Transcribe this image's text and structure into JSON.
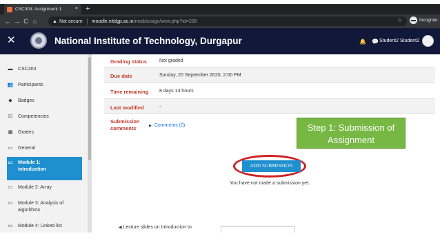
{
  "browser": {
    "tab_title": "CSC303: Assignment 1",
    "tab_close": "×",
    "new_tab": "+",
    "security_label": "Not secure",
    "url_host": "moodle.nitdgp.ac.in",
    "url_path": "/mod/assign/view.php?id=208",
    "incognito_label": "Incognito",
    "back_icon": "←",
    "forward_icon": "→",
    "reload_icon": "C",
    "home_icon": "⌂",
    "warning_icon": "▲",
    "star_icon": "☆"
  },
  "navbar": {
    "close_icon": "✕",
    "site_title": "National Institute of Technology, Durgapur",
    "bell_icon": "🔔",
    "message_icon": "💬",
    "user_name": "Student2 Student2"
  },
  "sidebar": {
    "items": [
      {
        "icon": "▬",
        "label": "CSC303"
      },
      {
        "icon": "👥",
        "label": "Participants"
      },
      {
        "icon": "◆",
        "label": "Badges"
      },
      {
        "icon": "☑",
        "label": "Competencies"
      },
      {
        "icon": "▦",
        "label": "Grades"
      },
      {
        "icon": "▭",
        "label": "General"
      },
      {
        "icon": "▭",
        "label": "Module 1: introduction"
      },
      {
        "icon": "▭",
        "label": "Module 2: Array"
      },
      {
        "icon": "▭",
        "label": "Module 3: Analysis of algorithms"
      },
      {
        "icon": "▭",
        "label": "Module 4: Linked list"
      }
    ]
  },
  "status": {
    "rows": [
      {
        "label": "Grading status",
        "value": "Not graded"
      },
      {
        "label": "Due date",
        "value": "Sunday, 20 September 2020, 2:00 PM"
      },
      {
        "label": "Time remaining",
        "value": "8 days 13 hours"
      },
      {
        "label": "Last modified",
        "value": "-"
      },
      {
        "label": "Submission comments",
        "value": "Comments (0)"
      }
    ]
  },
  "actions": {
    "add_submission": "ADD SUBMISSION",
    "no_submission_text": "You have not made a submission yet."
  },
  "callout": {
    "text": "Step 1: Submission of Assignment"
  },
  "footer": {
    "lecture_link": "Lecture slides on Introduction to"
  },
  "colors": {
    "navbar_bg": "#11183a",
    "accent_blue": "#1f8fd0",
    "label_red": "#c0392b",
    "callout_green": "#76b843",
    "highlight_red": "#cc1f1f"
  }
}
